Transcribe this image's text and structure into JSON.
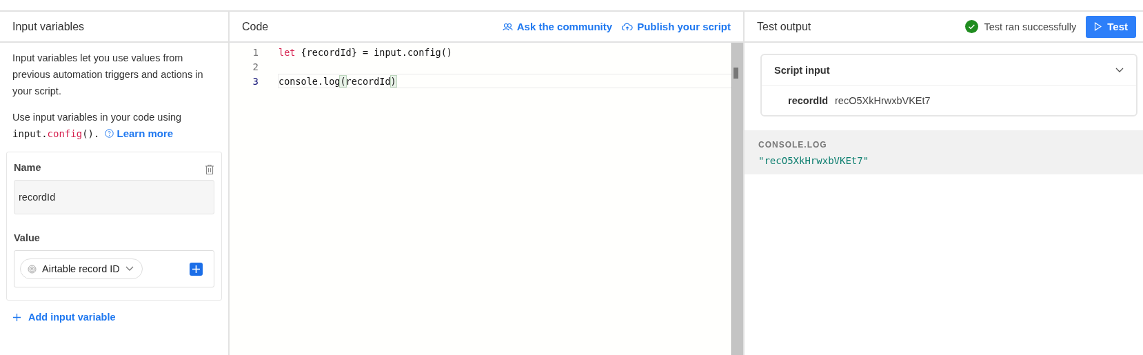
{
  "input_panel": {
    "title": "Input variables",
    "intro": "Input variables let you use values from previous automation triggers and actions in your script.",
    "usage": [
      {
        "kind": "text",
        "text": "Use input variables in your code using "
      },
      {
        "kind": "code",
        "text": "input."
      },
      {
        "kind": "accent",
        "text": "config"
      },
      {
        "kind": "code",
        "text": "()."
      }
    ],
    "learn_more": "Learn more",
    "variable": {
      "name_label": "Name",
      "name_value": "recordId",
      "value_label": "Value",
      "value_pill": "Airtable record ID"
    },
    "add_button": "Add input variable"
  },
  "code_panel": {
    "title": "Code",
    "links": [
      {
        "kind": "community",
        "label": "Ask the community"
      },
      {
        "kind": "publish",
        "label": "Publish your script"
      }
    ],
    "lines": [
      {
        "number": "1",
        "active": false,
        "tokens": [
          {
            "kind": "keyword",
            "text": "let"
          },
          {
            "kind": "plain",
            "text": " {recordId} = input.config()"
          }
        ]
      },
      {
        "number": "2",
        "active": false
      },
      {
        "number": "3",
        "active": true,
        "tokens": [
          {
            "kind": "plain",
            "text": "console.log"
          },
          {
            "kind": "bracket",
            "text": "("
          },
          {
            "kind": "plain",
            "text": "recordId"
          },
          {
            "kind": "bracket",
            "text": ")"
          }
        ]
      }
    ]
  },
  "output_panel": {
    "title": "Test output",
    "status": "Test ran successfully",
    "test_button": "Test",
    "script_input": {
      "title": "Script input",
      "expanded": true,
      "rows": [
        {
          "key": "recordId",
          "value": "recO5XkHrwxbVKEt7"
        }
      ]
    },
    "console": {
      "label": "CONSOLE.LOG",
      "output": "\"recO5XkHrwxbVKEt7\""
    }
  }
}
